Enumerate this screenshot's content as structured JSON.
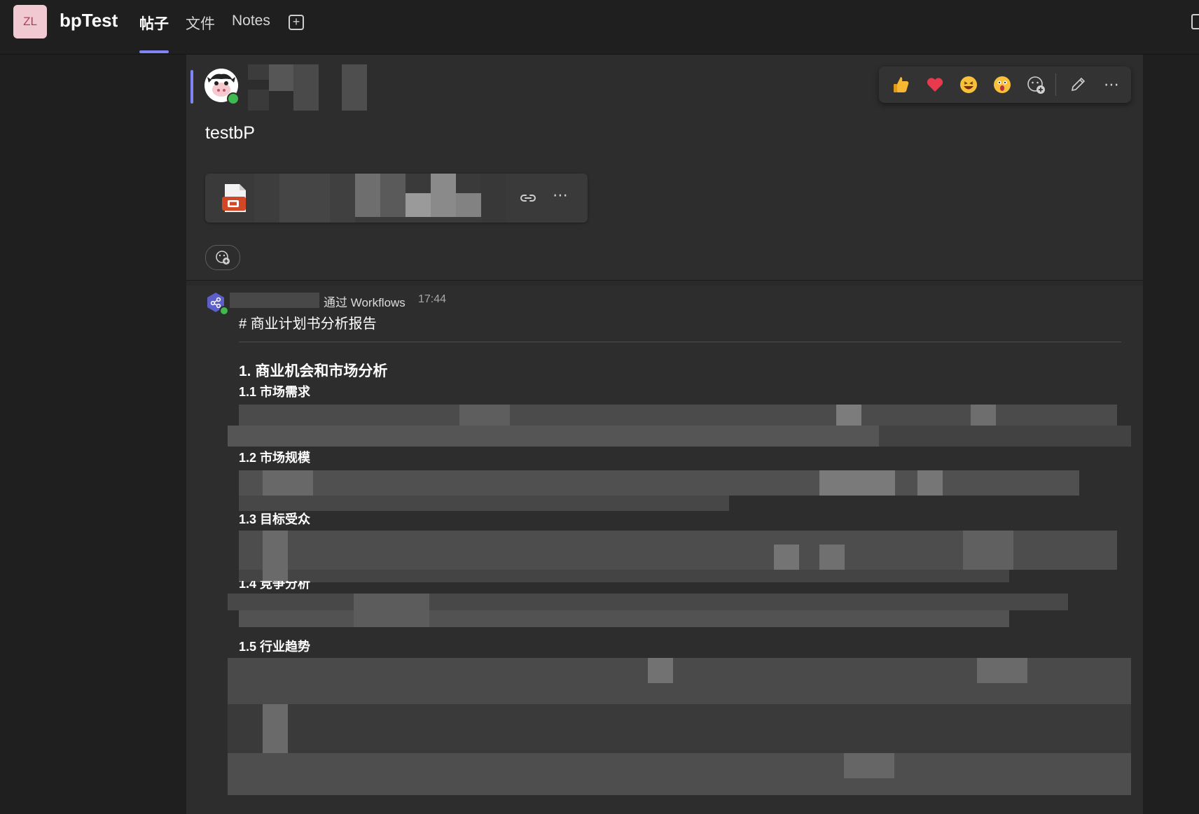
{
  "header": {
    "team_initials": "ZL",
    "team_name": "bpTest",
    "tabs": [
      {
        "label": "帖子",
        "active": true
      },
      {
        "label": "文件",
        "active": false
      },
      {
        "label": "Notes",
        "active": false
      }
    ],
    "add_tab_icon": "plus-square-icon"
  },
  "post": {
    "title": "testbP",
    "attachment": {
      "file_icon": "powerpoint-file-icon",
      "link_icon": "link-icon",
      "more_icon": "more-icon"
    },
    "react_button_icon": "add-reaction-icon"
  },
  "reaction_bar": {
    "items": [
      "thumbs-up-emoji",
      "heart-emoji",
      "laughing-emoji",
      "surprised-emoji",
      "add-reaction-icon",
      "edit-icon",
      "more-options-icon"
    ]
  },
  "reply": {
    "via_text": "通过 Workflows",
    "time": "17:44",
    "heading1": "# 商业计划书分析报告",
    "section1": "1. 商业机会和市场分析",
    "subsections": [
      "1.1 市场需求",
      "1.2 市场规模",
      "1.3 目标受众",
      "1.4 竞争分析",
      "1.5 行业趋势"
    ]
  },
  "colors": {
    "accent": "#7f85f5",
    "background": "#1f1f1f",
    "panel": "#2d2d2d",
    "presence": "#3fb950"
  }
}
